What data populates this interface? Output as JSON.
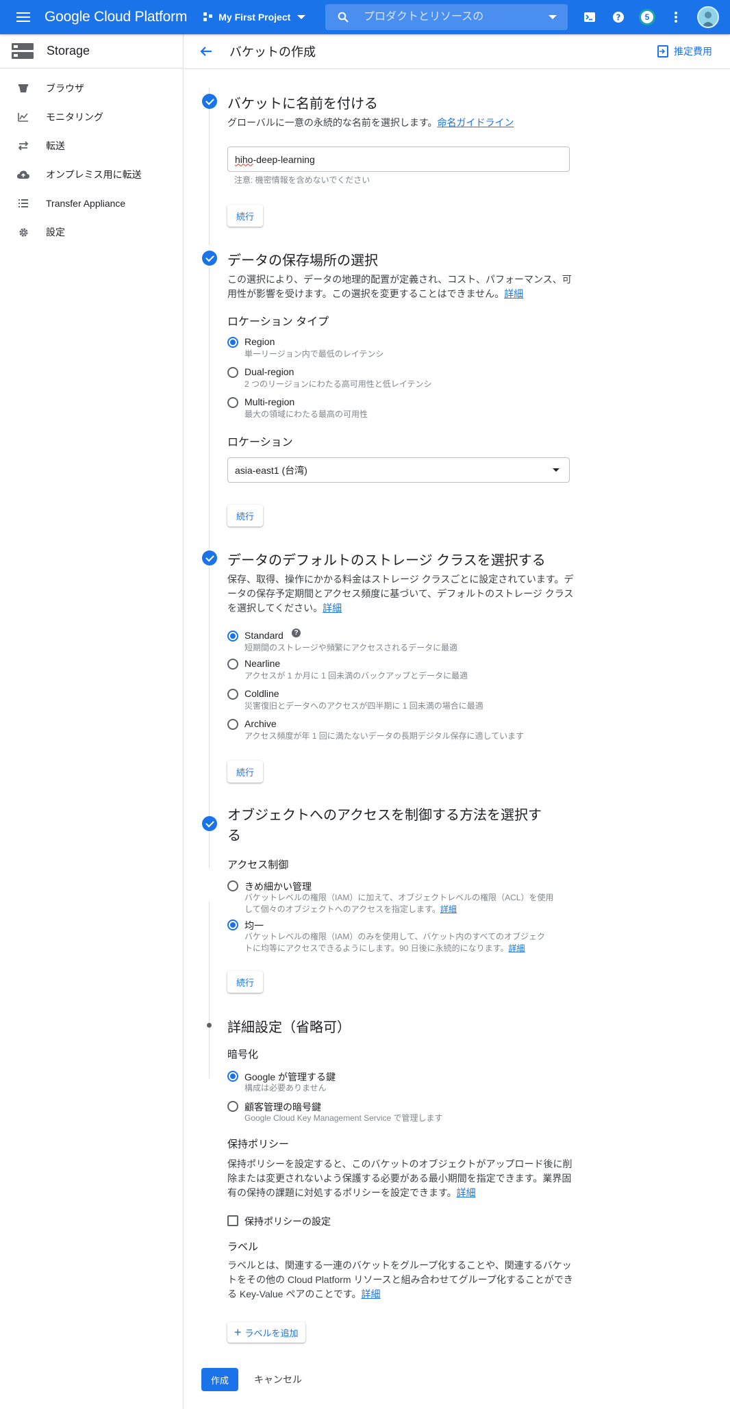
{
  "topbar": {
    "brand": "Google Cloud Platform",
    "project": "My First Project",
    "search_placeholder": "プロダクトとリソースの",
    "notification_count": "5"
  },
  "sidebar": {
    "title": "Storage",
    "items": [
      {
        "label": "ブラウザ",
        "icon": "bucket-icon"
      },
      {
        "label": "モニタリング",
        "icon": "chart-icon"
      },
      {
        "label": "転送",
        "icon": "transfer-icon"
      },
      {
        "label": "オンプレミス用に転送",
        "icon": "cloud-upload-icon"
      },
      {
        "label": "Transfer Appliance",
        "icon": "list-icon"
      },
      {
        "label": "設定",
        "icon": "gear-icon"
      }
    ]
  },
  "header": {
    "title": "バケットの作成",
    "cost_label": "推定費用"
  },
  "step1": {
    "title": "バケットに名前を付ける",
    "desc": "グローバルに一意の永続的な名前を選択します。",
    "link": "命名ガイドライン",
    "name_prefix": "hiho",
    "name_suffix": "-deep-learning",
    "hint": "注意: 機密情報を含めないでください",
    "continue": "続行"
  },
  "step2": {
    "title": "データの保存場所の選択",
    "desc_line1": "この選択により、データの地理的配置が定義され、コスト、パフォーマンス、可",
    "desc_line2": "用性が影響を受けます。この選択を変更することはできません。",
    "link": "詳細",
    "location_type_label": "ロケーション タイプ",
    "options": [
      {
        "label": "Region",
        "sub": "単一リージョン内で最低のレイテンシ",
        "selected": true
      },
      {
        "label": "Dual-region",
        "sub": "2 つのリージョンにわたる高可用性と低レイテンシ",
        "selected": false
      },
      {
        "label": "Multi-region",
        "sub": "最大の領域にわたる最高の可用性",
        "selected": false
      }
    ],
    "location_label": "ロケーション",
    "location_value": "asia-east1 (台湾)",
    "continue": "続行"
  },
  "step3": {
    "title": "データのデフォルトのストレージ クラスを選択する",
    "desc_line1": "保存、取得、操作にかかる料金はストレージ クラスごとに設定されています。デ",
    "desc_line2": "ータの保存予定期間とアクセス頻度に基づいて、デフォルトのストレージ クラス",
    "desc_line3": "を選択してください。",
    "link": "詳細",
    "options": [
      {
        "label": "Standard",
        "sub": "短期間のストレージや頻繁にアクセスされるデータに最適",
        "selected": true
      },
      {
        "label": "Nearline",
        "sub": "アクセスが 1 か月に 1 回未満のバックアップとデータに最適",
        "selected": false
      },
      {
        "label": "Coldline",
        "sub": "災害復旧とデータへのアクセスが四半期に 1 回未満の場合に最適",
        "selected": false
      },
      {
        "label": "Archive",
        "sub": "アクセス頻度が年 1 回に満たないデータの長期デジタル保存に適しています",
        "selected": false
      }
    ],
    "continue": "続行"
  },
  "step4": {
    "title_line1": "オブジェクトへのアクセスを制御する方法を選択す",
    "title_line2": "る",
    "access_label": "アクセス制御",
    "fine": {
      "label": "きめ細かい管理",
      "sub_line1": "バケットレベルの権限（IAM）に加えて、オブジェクトレベルの権限（ACL）を使用",
      "sub_line2": "して個々のオブジェクトへのアクセスを指定します。",
      "link": "詳細"
    },
    "uniform": {
      "label": "均一",
      "sub_line1": "バケットレベルの権限（IAM）のみを使用して、バケット内のすべてのオブジェク",
      "sub_line2": "トに均等にアクセスできるようにします。90 日後に永続的になります。",
      "link": "詳細"
    },
    "continue": "続行"
  },
  "step5": {
    "title": "詳細設定（省略可）",
    "encryption_label": "暗号化",
    "enc_google": {
      "label": "Google が管理する鍵",
      "sub": "構成は必要ありません"
    },
    "enc_customer": {
      "label": "顧客管理の暗号鍵",
      "sub": "Google Cloud Key Management Service で管理します"
    },
    "retention_label": "保持ポリシー",
    "retention_line1": "保持ポリシーを設定すると、このバケットのオブジェクトがアップロード後に削",
    "retention_line2": "除または変更されないよう保護する必要がある最小期間を指定できます。業界固",
    "retention_line3": "有の保持の課題に対処するポリシーを設定できます。",
    "retention_link": "詳細",
    "retention_checkbox": "保持ポリシーの設定",
    "labels_label": "ラベル",
    "labels_line1": "ラベルとは、関連する一連のバケットをグループ化することや、関連するバケッ",
    "labels_line2": "トをその他の Cloud Platform リソースと組み合わせてグループ化することができ",
    "labels_line3": "る Key-Value ペアのことです。",
    "labels_link": "詳細",
    "add_label": "ラベルを追加"
  },
  "footer": {
    "create": "作成",
    "cancel": "キャンセル"
  },
  "colors": {
    "accent": "#1a73e8"
  }
}
